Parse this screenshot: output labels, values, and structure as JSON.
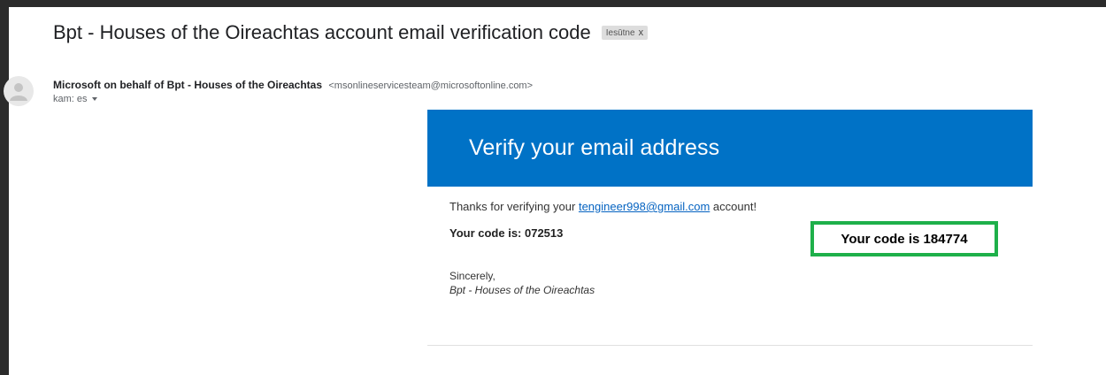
{
  "email": {
    "subject": "Bpt - Houses of the Oireachtas account email verification code",
    "label_chip": "Iesūtne",
    "label_close": "x",
    "sender_name": "Microsoft on behalf of Bpt - Houses of the Oireachtas",
    "sender_email": "<msonlineservicesteam@microsoftonline.com>",
    "recipient": "kam: es"
  },
  "message": {
    "banner_title": "Verify your email address",
    "thanks_prefix": "Thanks for verifying your ",
    "thanks_email": "tengineer998@gmail.com",
    "thanks_suffix": " account!",
    "code_line": "Your code is: 072513",
    "highlight_code": "Your code is 184774",
    "sign_off": "Sincerely,",
    "signature": "Bpt - Houses of the Oireachtas"
  },
  "colors": {
    "banner": "#0072c6",
    "highlight_border": "#1eb04a",
    "link": "#0563c1"
  }
}
